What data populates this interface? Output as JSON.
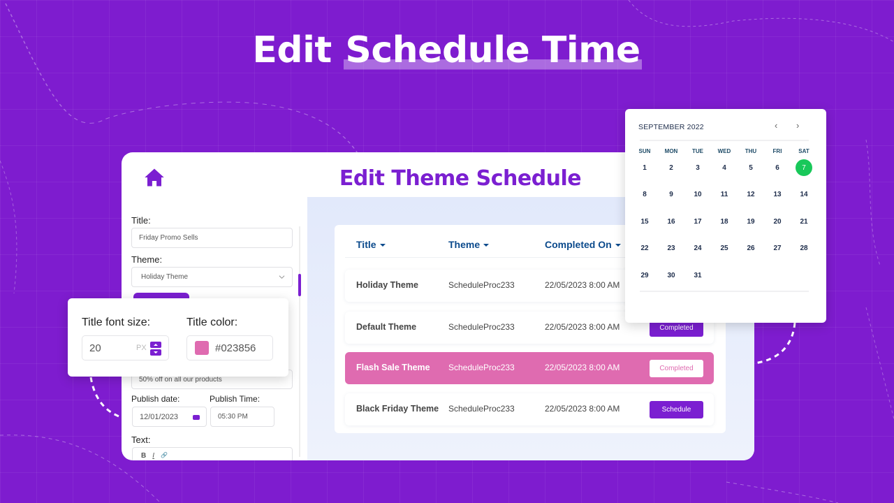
{
  "hero": {
    "title_plain": "Edit ",
    "title_highlight": "Schedule Time"
  },
  "app": {
    "title": "Edit Theme Schedule",
    "form": {
      "title_label": "Title:",
      "title_value": "Friday Promo Sells",
      "theme_label": "Theme:",
      "theme_value": "Holiday Theme",
      "description_value": "50% off on all our products",
      "publish_date_label": "Publish date:",
      "publish_date_value": "12/01/2023",
      "publish_time_label": "Publish Time:",
      "publish_time_value": "05:30  PM",
      "text_label": "Text:",
      "format_buttons": [
        "B",
        "I",
        "🔗"
      ]
    },
    "table": {
      "headers": [
        "Title",
        "Theme",
        "Completed On"
      ],
      "rows": [
        {
          "title": "Holiday Theme",
          "theme": "ScheduleProc233",
          "completed_on": "22/05/2023  8:00 AM",
          "status": "",
          "highlighted": false
        },
        {
          "title": "Default Theme",
          "theme": "ScheduleProc233",
          "completed_on": "22/05/2023  8:00 AM",
          "status": "Completed",
          "highlighted": false
        },
        {
          "title": "Flash Sale Theme",
          "theme": "ScheduleProc233",
          "completed_on": "22/05/2023  8:00 AM",
          "status": "Completed",
          "highlighted": true
        },
        {
          "title": "Black Friday Theme",
          "theme": "ScheduleProc233",
          "completed_on": "22/05/2023  8:00 AM",
          "status": "Schedule",
          "highlighted": false
        }
      ]
    }
  },
  "font_popover": {
    "font_size_label": "Title font size:",
    "font_size_value": "20",
    "font_size_unit": "PX",
    "color_label": "Title color:",
    "color_value": "#023856",
    "swatch_color": "#df6bb0"
  },
  "calendar": {
    "month_label": "SEPTEMBER 2022",
    "prev": "‹",
    "next": "›",
    "weekdays": [
      "SUN",
      "MON",
      "TUE",
      "WED",
      "THU",
      "FRI",
      "SAT"
    ],
    "weeks": [
      [
        "1",
        "2",
        "3",
        "4",
        "5",
        "6",
        "7"
      ],
      [
        "8",
        "9",
        "10",
        "11",
        "12",
        "13",
        "14"
      ],
      [
        "15",
        "16",
        "17",
        "18",
        "19",
        "20",
        "21"
      ],
      [
        "22",
        "23",
        "24",
        "25",
        "26",
        "27",
        "28"
      ],
      [
        "29",
        "30",
        "31",
        "",
        "",
        "",
        ""
      ]
    ],
    "selected_day": "7",
    "selected_color": "#19c85a"
  },
  "colors": {
    "background": "#7e1ccf",
    "accent": "#7b1fd1",
    "pink": "#df6bb0",
    "header_blue": "#0b4a8c"
  }
}
